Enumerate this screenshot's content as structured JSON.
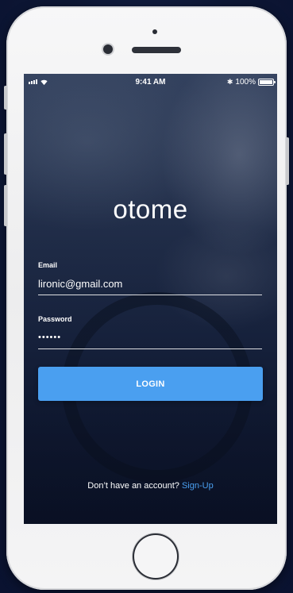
{
  "status_bar": {
    "time": "9:41 AM",
    "battery_percent": "100%",
    "bluetooth_icon": "bluetooth-icon",
    "signal_icon": "cellular-signal-icon",
    "wifi_icon": "wifi-icon",
    "battery_level": 1.0
  },
  "app": {
    "logo_text": "otome"
  },
  "form": {
    "email_label": "Email",
    "email_value": "lironic@gmail.com",
    "password_label": "Password",
    "password_value": "••••••",
    "login_label": "LOGIN"
  },
  "footer": {
    "prompt": "Don’t have an account?",
    "signup_link": "Sign-Up"
  },
  "colors": {
    "accent": "#4a9ff0",
    "text": "#ffffff",
    "device_frame": "#f2f2f3",
    "background": "#0f1a3a"
  }
}
